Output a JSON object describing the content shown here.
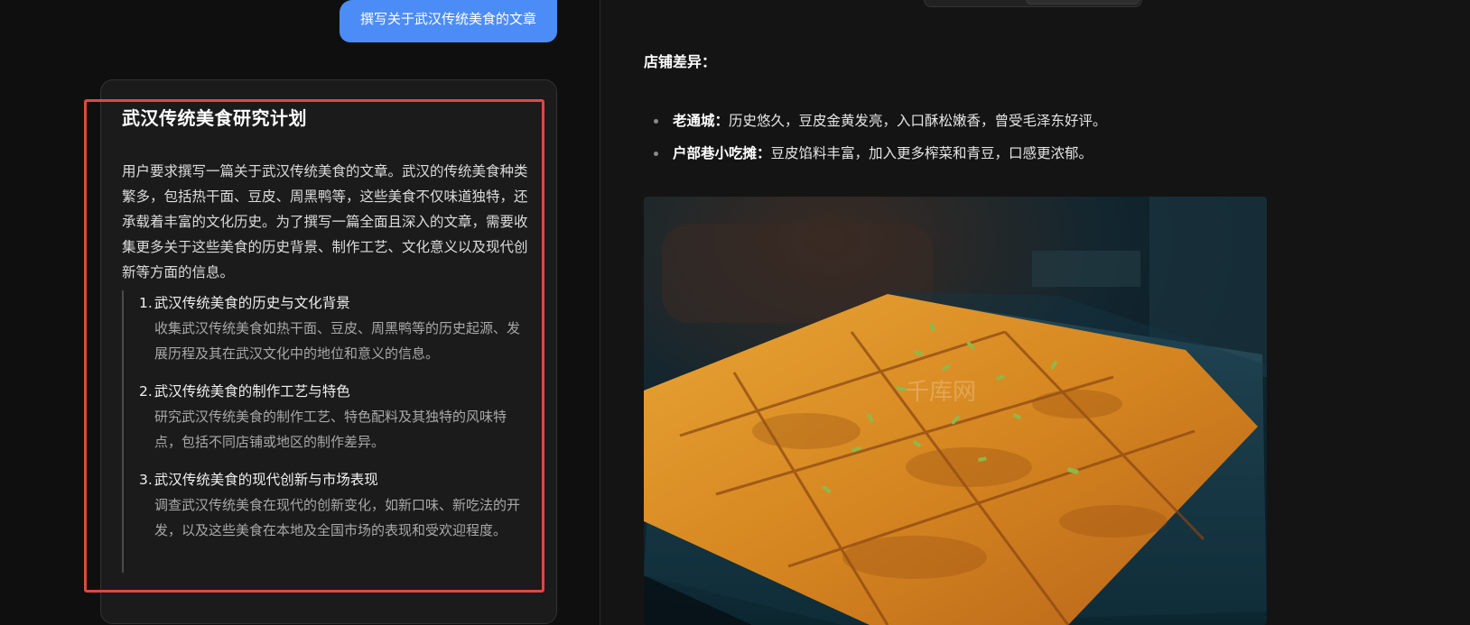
{
  "chat": {
    "user_message": "撰写关于武汉传统美食的文章"
  },
  "plan": {
    "title": "武汉传统美食研究计划",
    "intro": "用户要求撰写一篇关于武汉传统美食的文章。武汉的传统美食种类繁多，包括热干面、豆皮、周黑鸭等，这些美食不仅味道独特，还承载着丰富的文化历史。为了撰写一篇全面且深入的文章，需要收集更多关于这些美食的历史背景、制作工艺、文化意义以及现代创新等方面的信息。",
    "steps": [
      {
        "num": "1.",
        "title": "武汉传统美食的历史与文化背景",
        "desc": "收集武汉传统美食如热干面、豆皮、周黑鸭等的历史起源、发展历程及其在武汉文化中的地位和意义的信息。"
      },
      {
        "num": "2.",
        "title": "武汉传统美食的制作工艺与特色",
        "desc": "研究武汉传统美食的制作工艺、特色配料及其独特的风味特点，包括不同店铺或地区的制作差异。"
      },
      {
        "num": "3.",
        "title": "武汉传统美食的现代创新与市场表现",
        "desc": "调查武汉传统美食在现代的创新变化，如新口味、新吃法的开发，以及这些美食在本地及全国市场的表现和受欢迎程度。"
      }
    ]
  },
  "article": {
    "section_heading": "店铺差异：",
    "bullets": [
      {
        "name": "老通城",
        "sep": "：",
        "text": "历史悠久，豆皮金黄发亮，入口酥松嫩香，曾受毛泽东好评。"
      },
      {
        "name": "户部巷小吃摊",
        "sep": "：",
        "text": "豆皮馅料丰富，加入更多榨菜和青豆，口感更浓郁。"
      }
    ],
    "photo_icon": "doupi-food-photo",
    "watermark": "千库网"
  },
  "colors": {
    "user_bubble": "#4c8cf7",
    "highlight": "#e0483e",
    "panel_bg": "#141414",
    "card_bg": "#1b1b1b"
  }
}
